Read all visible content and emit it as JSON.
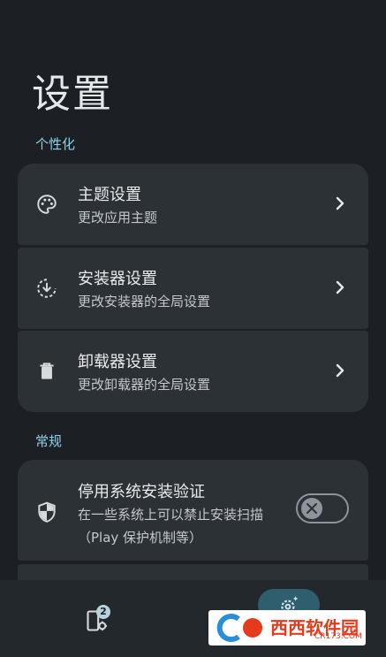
{
  "page_title": "设置",
  "sections": {
    "personalization": "个性化",
    "general": "常规"
  },
  "rows": [
    {
      "title": "主题设置",
      "subtitle": "更改应用主题",
      "icon": "palette-icon"
    },
    {
      "title": "安装器设置",
      "subtitle": "更改安装器的全局设置",
      "icon": "install-download-icon"
    },
    {
      "title": "卸载器设置",
      "subtitle": "更改卸载器的全局设置",
      "icon": "trash-icon"
    }
  ],
  "toggle_row": {
    "title": "停用系统安装验证",
    "subtitle": "在一些系统上可以禁止安装扫描（Play 保护机制等）",
    "icon": "shield-icon",
    "enabled": false
  },
  "bottom_nav": {
    "installer_badge": "2",
    "items": [
      "installer-icon",
      "settings-icon"
    ],
    "selected": "settings-icon"
  },
  "watermark": {
    "text": "西西软件园",
    "sub": "CR173.COM"
  },
  "colors": {
    "background": "#1c2024",
    "card": "#2c3135",
    "accent": "#8fd0e6",
    "nav_pill": "#2f5f6e"
  }
}
